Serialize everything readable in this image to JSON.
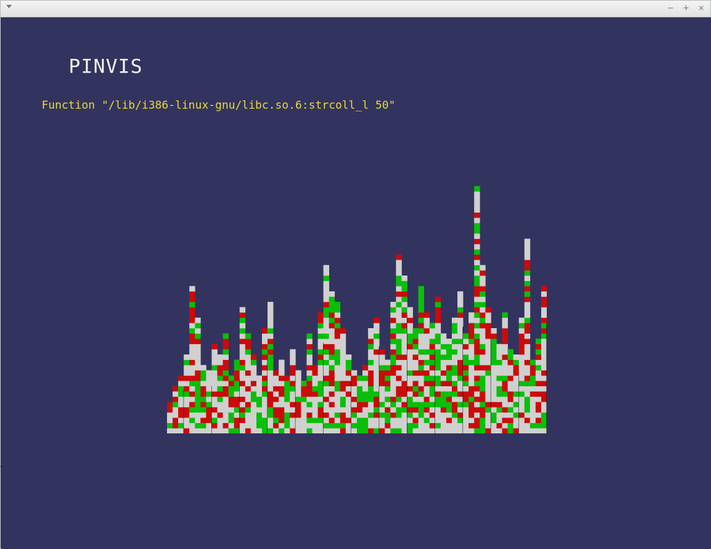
{
  "window": {
    "title": "",
    "menu_icon": "chevron-down-icon",
    "controls": {
      "minimize_glyph": "−",
      "maximize_glyph": "+",
      "close_glyph": "×"
    }
  },
  "app": {
    "title": "PINVIS",
    "function_label": "Function \"/lib/i386-linux-gnu/libc.so.6:strcoll_l 50\""
  },
  "colors": {
    "background": "#33335f",
    "title_text": "#f2f2f2",
    "label_text": "#e7d93a",
    "cell_gray": "#d0d0d0",
    "cell_red": "#cc0a0a",
    "cell_green": "#08c008",
    "outline": "#111111"
  },
  "chart_data": {
    "type": "bar",
    "description_note": "",
    "columns": 68,
    "values": [
      6,
      9,
      11,
      15,
      28,
      22,
      13,
      12,
      17,
      15,
      19,
      11,
      14,
      24,
      19,
      15,
      11,
      20,
      25,
      12,
      14,
      11,
      16,
      12,
      10,
      19,
      13,
      23,
      32,
      27,
      25,
      20,
      15,
      12,
      11,
      13,
      20,
      22,
      16,
      14,
      25,
      34,
      30,
      24,
      20,
      28,
      23,
      21,
      26,
      19,
      18,
      22,
      27,
      19,
      23,
      47,
      32,
      24,
      20,
      17,
      23,
      16,
      15,
      22,
      37,
      14,
      18,
      28
    ],
    "cell_sequences": [
      "gnggrgrgrgg",
      "rgnrgrgggrgrr",
      "grngrgnrgrrgr",
      "gngrgrrngrgrgrr",
      "rgrgrggrgrgrgrgrrrgrgrgrgrgg"
    ]
  }
}
